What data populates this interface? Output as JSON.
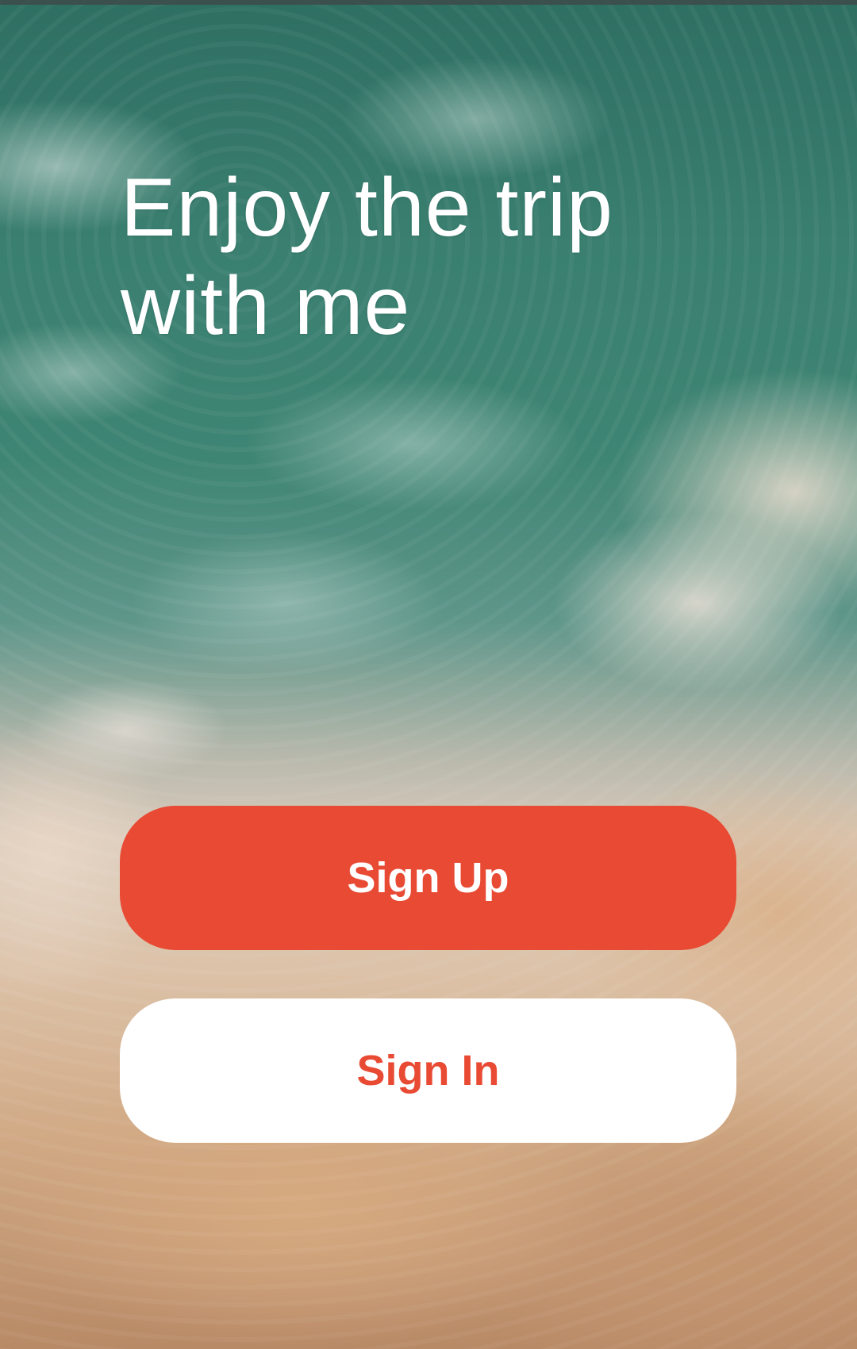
{
  "headline": {
    "line1": "Enjoy the trip",
    "line2": "with me"
  },
  "buttons": {
    "sign_up": "Sign Up",
    "sign_in": "Sign In"
  },
  "colors": {
    "accent": "#e84a33",
    "button_light": "#ffffff",
    "headline_text": "#ffffff"
  },
  "background": {
    "icon": "sea-and-salt-shore-photo"
  }
}
